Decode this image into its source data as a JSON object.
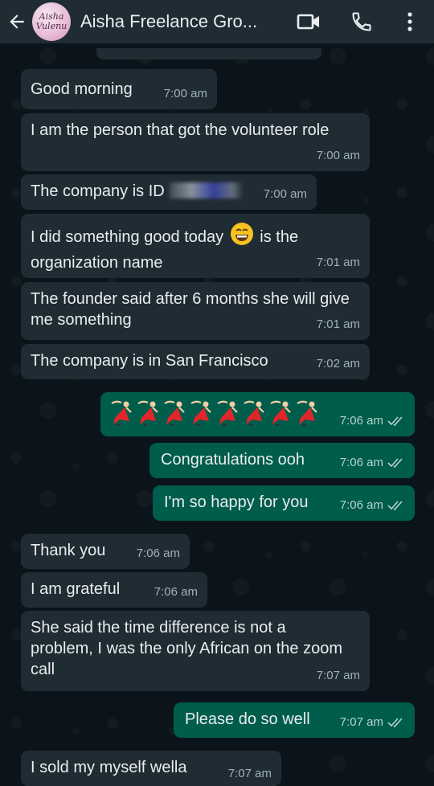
{
  "header": {
    "back_icon": "arrow-left-icon",
    "avatar_text_1": "Aisha",
    "avatar_text_2": "Vulenu",
    "title": "Aisha Freelance Gro...",
    "video_icon": "video-call-icon",
    "call_icon": "phone-icon",
    "menu_icon": "more-vertical-icon"
  },
  "messages": [
    {
      "dir": "in",
      "text": "Good morning",
      "time": "7:00 am"
    },
    {
      "dir": "in",
      "text": "I am the person that got the volunteer role",
      "time": "7:00 am"
    },
    {
      "dir": "in",
      "text": "The company is ID",
      "redacted": true,
      "time": "7:00 am"
    },
    {
      "dir": "in",
      "text_before": "I did something good today",
      "emoji": "grinning-face-emoji",
      "text_after": "is the organization name",
      "time": "7:01 am"
    },
    {
      "dir": "in",
      "text": "The founder said after 6 months she will give me something",
      "time": "7:01 am"
    },
    {
      "dir": "in",
      "text": "The company is in San Francisco",
      "time": "7:02 am"
    },
    {
      "dir": "out",
      "emoji_row": "dancer-emoji",
      "emoji_count": 8,
      "time": "7:06 am",
      "status": "read"
    },
    {
      "dir": "out",
      "text": "Congratulations ooh",
      "time": "7:06 am",
      "status": "read"
    },
    {
      "dir": "out",
      "text": "I'm so happy for you",
      "time": "7:06 am",
      "status": "read"
    },
    {
      "dir": "in",
      "text": "Thank you",
      "time": "7:06 am"
    },
    {
      "dir": "in",
      "text": "I am grateful",
      "time": "7:06 am"
    },
    {
      "dir": "in",
      "text": "She said the time difference is not a problem, I was the only African on the zoom call",
      "time": "7:07 am"
    },
    {
      "dir": "out",
      "text": "Please do so well",
      "time": "7:07 am",
      "status": "read"
    },
    {
      "dir": "in",
      "text": "I sold my myself wella",
      "time": "7:07 am"
    }
  ],
  "colors": {
    "background": "#0b141a",
    "header": "#1f2c34",
    "incoming_bubble": "#202c33",
    "outgoing_bubble": "#005c4b",
    "read_tick": "#b6d4cc"
  }
}
